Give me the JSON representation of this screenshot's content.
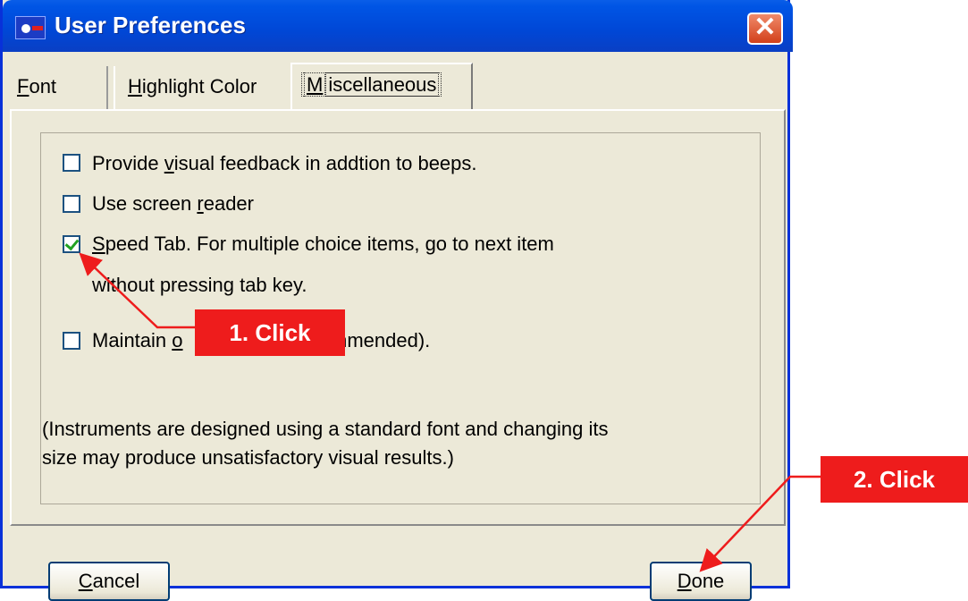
{
  "window": {
    "title": "User Preferences",
    "close_glyph": "✕"
  },
  "tabs": [
    {
      "label": "Font",
      "accel": "F",
      "rest": "ont",
      "selected": false
    },
    {
      "label": "Highlight Color",
      "accel": "H",
      "rest": "ighlight Color",
      "selected": false
    },
    {
      "label": "Miscellaneous",
      "accel": "M",
      "rest": "iscellaneous",
      "selected": true
    }
  ],
  "options": [
    {
      "pre": "Provide ",
      "accel": "v",
      "post": "isual feedback in addtion to beeps.",
      "checked": false
    },
    {
      "pre": "Use screen ",
      "accel": "r",
      "post": "eader",
      "checked": false
    },
    {
      "pre": "",
      "accel": "S",
      "post": "peed Tab. For multiple choice items, go to next item",
      "line2": "without pressing tab key.",
      "checked": true
    },
    {
      "pre": "Maintain ",
      "accel": "o",
      "post": "",
      "tail": "ecommended).",
      "checked": false
    }
  ],
  "note": {
    "line1": "(Instruments are designed using a standard font and changing its",
    "line2": "size may produce unsatisfactory visual results.)"
  },
  "buttons": {
    "cancel": {
      "accel": "C",
      "rest": "ancel"
    },
    "done": {
      "accel": "D",
      "rest": "one"
    }
  },
  "annotations": {
    "callout1": "1. Click",
    "callout2": "2. Click",
    "color": "#ee1c1c"
  },
  "colors": {
    "title_bar": "#0055e5",
    "dialog_bg": "#ece9d8",
    "check_mark": "#21a121"
  }
}
